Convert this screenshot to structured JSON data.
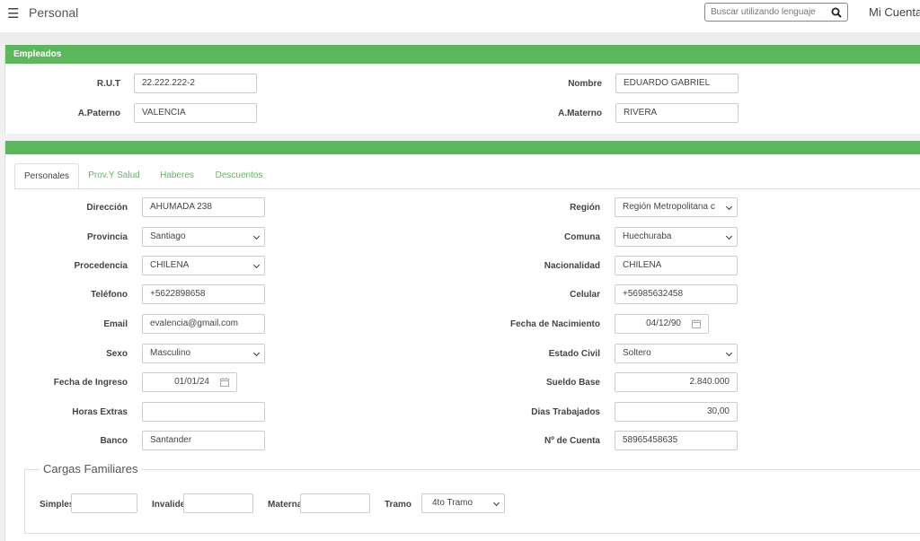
{
  "header": {
    "menu_icon": "hamburger-icon",
    "title": "Personal",
    "search_placeholder": "Buscar utilizando lenguaje",
    "search_icon": "search-icon",
    "account": "Mi Cuenta"
  },
  "employee_panel": {
    "title": "Empleados",
    "rut_label": "R.U.T",
    "rut_value": "22.222.222-2",
    "nombre_label": "Nombre",
    "nombre_value": "EDUARDO GABRIEL",
    "paterno_label": "A.Paterno",
    "paterno_value": "VALENCIA",
    "materno_label": "A.Materno",
    "materno_value": "RIVERA"
  },
  "tabs": [
    "Personales",
    "Prov.Y Salud",
    "Haberes",
    "Descuentos"
  ],
  "form": {
    "direccion": {
      "label": "Dirección",
      "value": "AHUMADA 238"
    },
    "region": {
      "label": "Región",
      "value": "Región Metropolitana c"
    },
    "provincia": {
      "label": "Provincia",
      "value": "Santiago"
    },
    "comuna": {
      "label": "Comuna",
      "value": "Huechuraba"
    },
    "procedencia": {
      "label": "Procedencia",
      "value": "CHILENA"
    },
    "nacionalidad": {
      "label": "Nacionalidad",
      "value": "CHILENA"
    },
    "telefono": {
      "label": "Teléfono",
      "value": "+5622898658"
    },
    "celular": {
      "label": "Celular",
      "value": "+56985632458"
    },
    "email": {
      "label": "Email",
      "value": "evalencia@gmail.com"
    },
    "nacimiento": {
      "label": "Fecha de Nacimiento",
      "value": "04/12/90"
    },
    "sexo": {
      "label": "Sexo",
      "value": "Masculino"
    },
    "estado_civil": {
      "label": "Estado Civil",
      "value": "Soltero"
    },
    "ingreso": {
      "label": "Fecha de Ingreso",
      "value": "01/01/24"
    },
    "sueldo": {
      "label": "Sueldo Base",
      "value": "2.840.000"
    },
    "horas": {
      "label": "Horas Extras",
      "value": ""
    },
    "dias": {
      "label": "Dias Trabajados",
      "value": "30,00"
    },
    "banco": {
      "label": "Banco",
      "value": "Santander"
    },
    "cuenta": {
      "label": "Nº de Cuenta",
      "value": "58965458635"
    }
  },
  "cargas": {
    "legend": "Cargas Familiares",
    "simples_label": "Simples",
    "simples_value": "",
    "invalidez_label": "Invalidez",
    "invalidez_value": "",
    "maternal_label": "Maternal",
    "maternal_value": "",
    "tramo_label": "Tramo",
    "tramo_value": "4to Tramo"
  }
}
